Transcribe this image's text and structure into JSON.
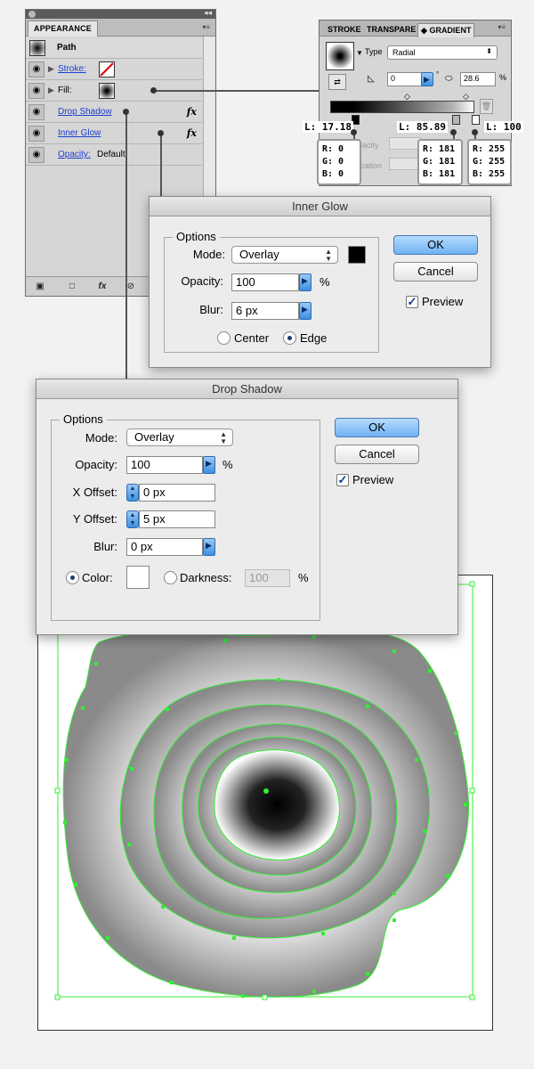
{
  "appearance": {
    "tab": "APPEARANCE",
    "path_label": "Path",
    "stroke_label": "Stroke:",
    "fill_label": "Fill:",
    "drop_shadow": "Drop Shadow",
    "inner_glow": "Inner Glow",
    "opacity_label": "Opacity:",
    "opacity_value": "Default",
    "fx": "fx"
  },
  "gradient": {
    "tabs": [
      "STROKE",
      "TRANSPARE",
      "GRADIENT"
    ],
    "active_tab_icon": "◆",
    "type_label": "Type",
    "type_value": "Radial",
    "angle_value": "0",
    "degree_sign": "°",
    "aspect_value": "28.6",
    "percent": "%",
    "opacity_label": "Opacity",
    "location_label": "Location",
    "stops": [
      {
        "label": "L: 17.18",
        "r": "R: 0",
        "g": "G: 0",
        "b": "B: 0"
      },
      {
        "label": "L: 85.89",
        "r": "R: 181",
        "g": "G: 181",
        "b": "B: 181"
      },
      {
        "label": "L: 100",
        "r": "R: 255",
        "g": "G: 255",
        "b": "B: 255"
      }
    ]
  },
  "inner_glow": {
    "title": "Inner Glow",
    "options": "Options",
    "mode_label": "Mode:",
    "mode_value": "Overlay",
    "opacity_label": "Opacity:",
    "opacity_value": "100",
    "percent": "%",
    "blur_label": "Blur:",
    "blur_value": "6 px",
    "center": "Center",
    "edge": "Edge",
    "ok": "OK",
    "cancel": "Cancel",
    "preview": "Preview",
    "glow_color": "#000000"
  },
  "drop_shadow": {
    "title": "Drop Shadow",
    "options": "Options",
    "mode_label": "Mode:",
    "mode_value": "Overlay",
    "opacity_label": "Opacity:",
    "opacity_value": "100",
    "percent": "%",
    "x_label": "X Offset:",
    "x_value": "0 px",
    "y_label": "Y Offset:",
    "y_value": "5 px",
    "blur_label": "Blur:",
    "blur_value": "0 px",
    "color_label": "Color:",
    "darkness_label": "Darkness:",
    "darkness_value": "100",
    "ok": "OK",
    "cancel": "Cancel",
    "preview": "Preview",
    "shadow_color": "#ffffff"
  },
  "colors": {
    "selection": "#33ee33",
    "link": "#1a3fd0",
    "primary_button": "#6fb2f3"
  }
}
